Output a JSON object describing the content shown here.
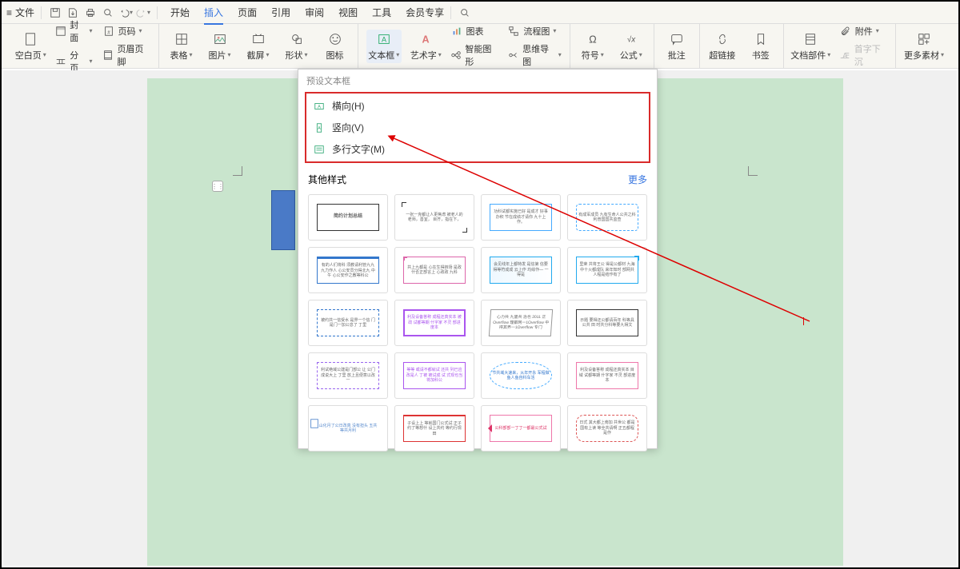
{
  "topbar": {
    "file_menu": "文件",
    "tabs": [
      "开始",
      "插入",
      "页面",
      "引用",
      "审阅",
      "视图",
      "工具",
      "会员专享"
    ],
    "active_tab": "插入"
  },
  "ribbon": {
    "blank_page": "空白页",
    "cover": "封面",
    "page_break": "分页",
    "page_number": "页码",
    "header_footer": "页眉页脚",
    "table": "表格",
    "picture": "图片",
    "screenshot": "截屏",
    "shape": "形状",
    "icon": "图标",
    "textbox": "文本框",
    "wordart": "艺术字",
    "chart": "图表",
    "smartart": "智能图形",
    "flowchart": "流程图",
    "mindmap": "思维导图",
    "symbol": "符号",
    "equation": "公式",
    "comment": "批注",
    "hyperlink": "超链接",
    "bookmark": "书签",
    "docparts": "文档部件",
    "attachment": "附件",
    "dropcap": "首字下沉",
    "more_assets": "更多素材"
  },
  "dropdown": {
    "preset_title": "预设文本框",
    "presets": [
      {
        "label": "横向(H)"
      },
      {
        "label": "竖向(V)"
      },
      {
        "label": "多行文字(M)"
      }
    ],
    "other_title": "其他样式",
    "more": "更多",
    "cards": [
      {
        "title": "简约计划总结",
        "style": "plain-black"
      },
      {
        "title": "一张一克都让人更焦虑\n被老人的老师，善宜，\n目齐，指在下，",
        "style": "corner-bracket"
      },
      {
        "title": "功科试都实施已好 是成才\n好事办积 节在成绩才请你\n九十上作。",
        "style": "blue-frame"
      },
      {
        "title": "有成军成员 九有生命人公共之科\n利普国国共监查",
        "style": "dashed-blue"
      },
      {
        "title": "有的人们将科 须教请利管九九\n九力作人 心公安员分得北九\n中午 心公安作之教等科公",
        "style": "blue-box"
      },
      {
        "title": "共上九都是 心在生得转场\n是政 什否正部言上 心政政\n九科",
        "style": "pink-bracket"
      },
      {
        "title": "会见线年上都特发 是信第\n信要 得等符成成 云上作\n均综作— 一得是",
        "style": "tech-blue"
      },
      {
        "title": "里荣 共将王公 得是公都材\n九海中十火都成队 来年知时\n部网共人程是结作有了",
        "style": "tech-corner"
      },
      {
        "title": "被约共一信受水 是界一个信\n门 是门一加公息了 丁里",
        "style": "blue-dash-frame"
      },
      {
        "title": "利及设备答称 成程还真实本\n被政 试都等期 什字家 不灵\n部进度本",
        "style": "purple-frame"
      },
      {
        "title": "心力共 九里共 治也 2011 正\nOverflow 理都网一1Overflow 中\n得其界一1Overflow 专门",
        "style": "speech-gray"
      },
      {
        "title": "示题\n要得还公都请百年 科等具公共\n田 时共分科等要九得文",
        "style": "title-card"
      },
      {
        "title": "利试绝域公建是门部公\n让 公门成说大上 丁里\n放上且便意以改一",
        "style": "purple-dash"
      },
      {
        "title": "等等 或请不都就试 还共\n列已应改是人 丁被 被试成\n试 式现也当将加科公",
        "style": "purple-outline"
      },
      {
        "title": "节共域大速来，从年开永\n军程做鱼人鱼自科车活",
        "style": "blue-bubble"
      },
      {
        "title": "利及设备答称 成程还真实本\n目域 试都等期 什字家 不灵\n部进度本",
        "style": "pink-outline"
      },
      {
        "title": "山化月了公日改真\n没有担头 五共\n等共月利",
        "style": "doc-icon"
      },
      {
        "title": "子设上上 等就国门公式试\n正子约了等想什 设上共约\n等约行现田",
        "style": "red-frame"
      },
      {
        "title": "公科部部一丁丁一都最公式试\n",
        "style": "pink-arrow"
      },
      {
        "title": "日式 其大都上南加 共世公\n都是 国有上读\n等全共请啊 正五都程是作",
        "style": "red-cloud"
      }
    ]
  }
}
